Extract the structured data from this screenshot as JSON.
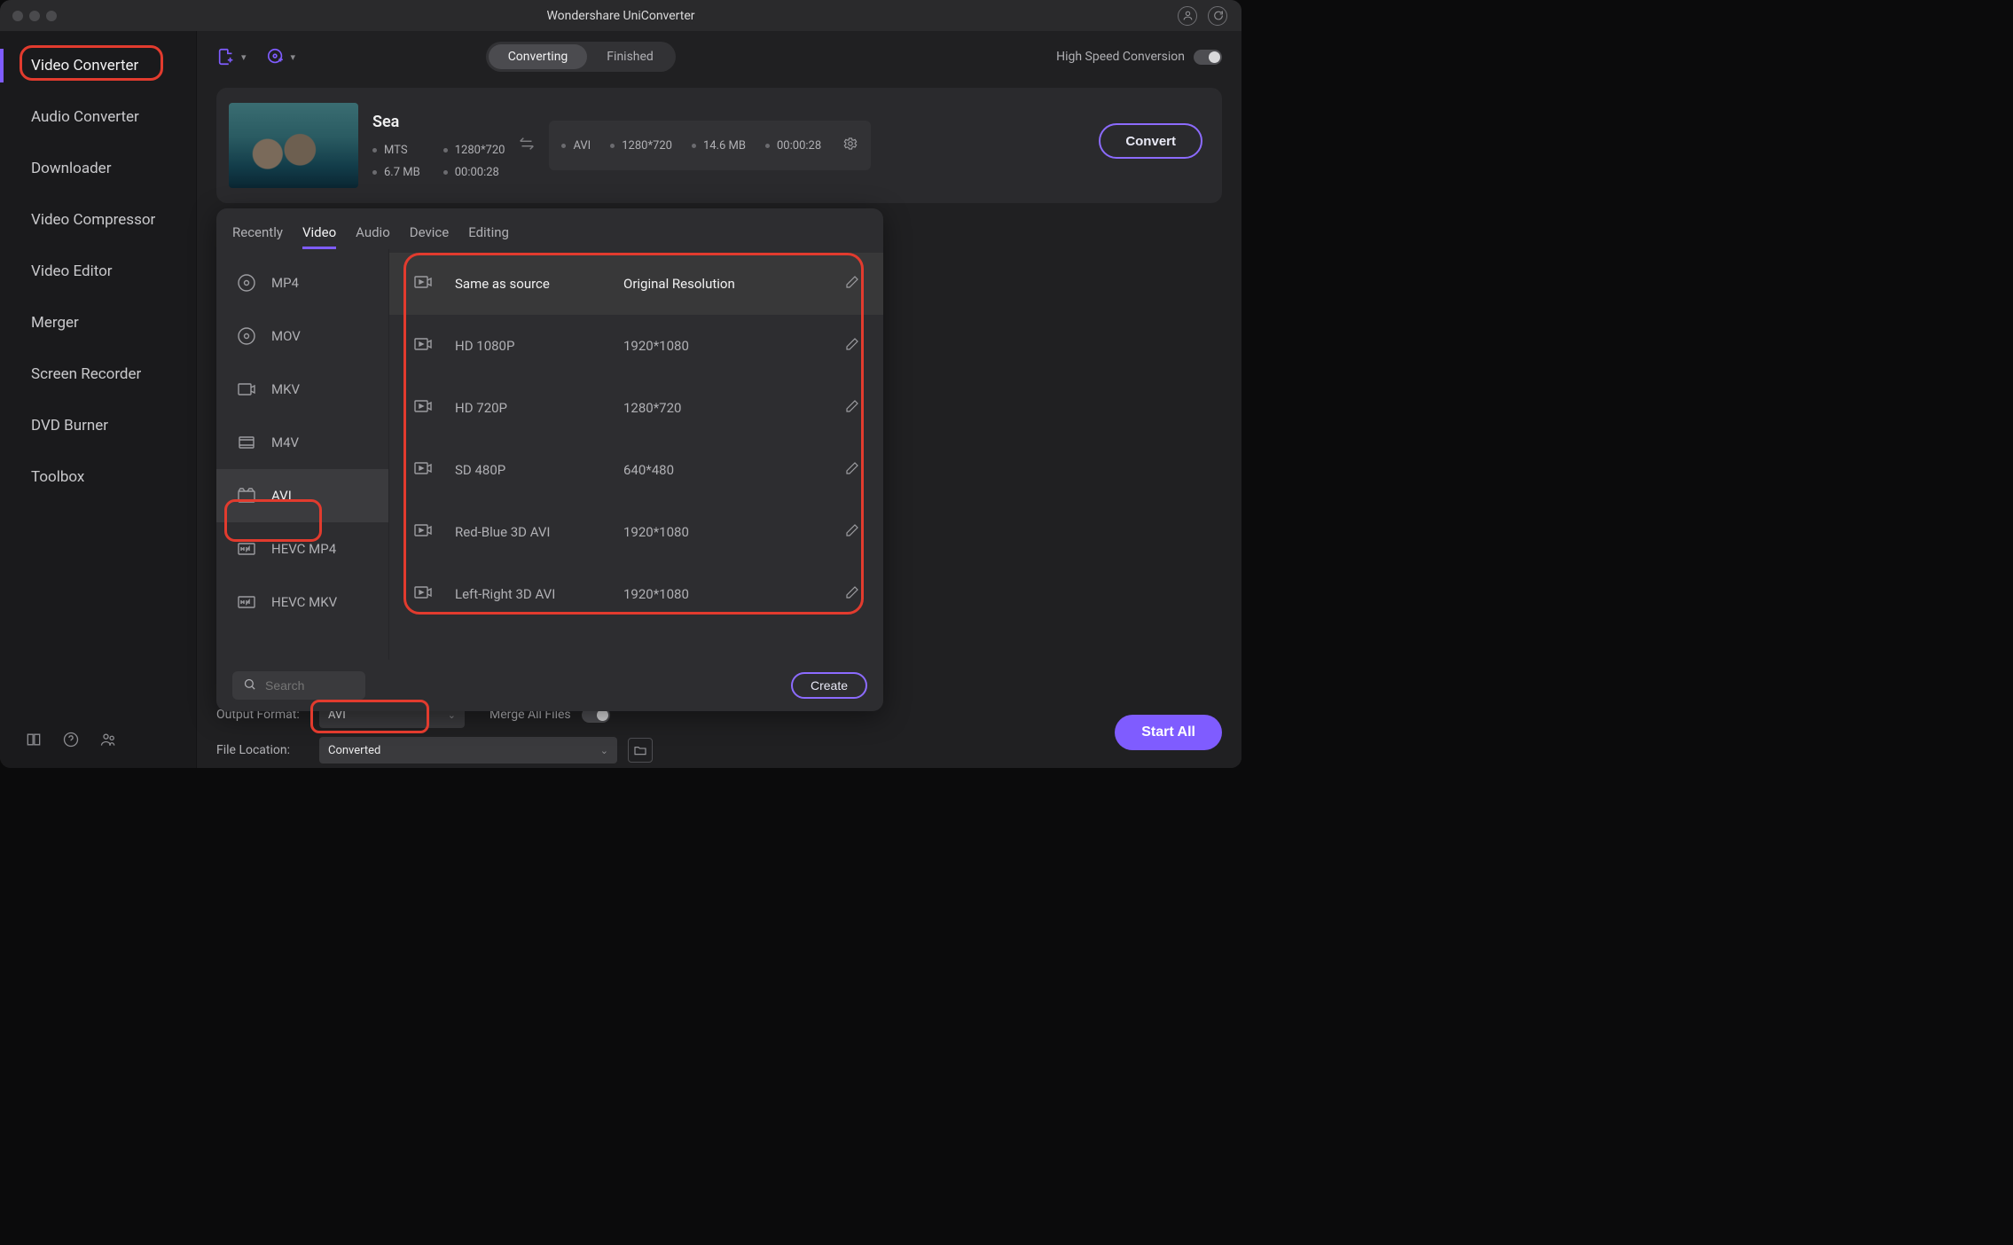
{
  "app": {
    "title": "Wondershare UniConverter"
  },
  "sidebar": {
    "items": [
      "Video Converter",
      "Audio Converter",
      "Downloader",
      "Video Compressor",
      "Video Editor",
      "Merger",
      "Screen Recorder",
      "DVD Burner",
      "Toolbox"
    ],
    "active_index": 0
  },
  "toolbar": {
    "tabs": {
      "converting": "Converting",
      "finished": "Finished"
    },
    "high_speed_label": "High Speed Conversion"
  },
  "item": {
    "title": "Sea",
    "src": {
      "container": "MTS",
      "resolution": "1280*720",
      "size": "6.7 MB",
      "duration": "00:00:28"
    },
    "dst": {
      "container": "AVI",
      "resolution": "1280*720",
      "size": "14.6 MB",
      "duration": "00:00:28"
    },
    "convert_label": "Convert"
  },
  "popup": {
    "tabs": [
      "Recently",
      "Video",
      "Audio",
      "Device",
      "Editing"
    ],
    "active_tab_index": 1,
    "formats": [
      "MP4",
      "MOV",
      "MKV",
      "M4V",
      "AVI",
      "HEVC MP4",
      "HEVC MKV"
    ],
    "active_format_index": 4,
    "presets": [
      {
        "name": "Same as source",
        "res": "Original Resolution"
      },
      {
        "name": "HD 1080P",
        "res": "1920*1080"
      },
      {
        "name": "HD 720P",
        "res": "1280*720"
      },
      {
        "name": "SD 480P",
        "res": "640*480"
      },
      {
        "name": "Red-Blue 3D AVI",
        "res": "1920*1080"
      },
      {
        "name": "Left-Right 3D AVI",
        "res": "1920*1080"
      }
    ],
    "search_placeholder": "Search",
    "create_label": "Create"
  },
  "bottom": {
    "output_format_label": "Output Format:",
    "output_format_value": "AVI",
    "merge_label": "Merge All Files",
    "file_location_label": "File Location:",
    "file_location_value": "Converted",
    "start_all_label": "Start All"
  }
}
